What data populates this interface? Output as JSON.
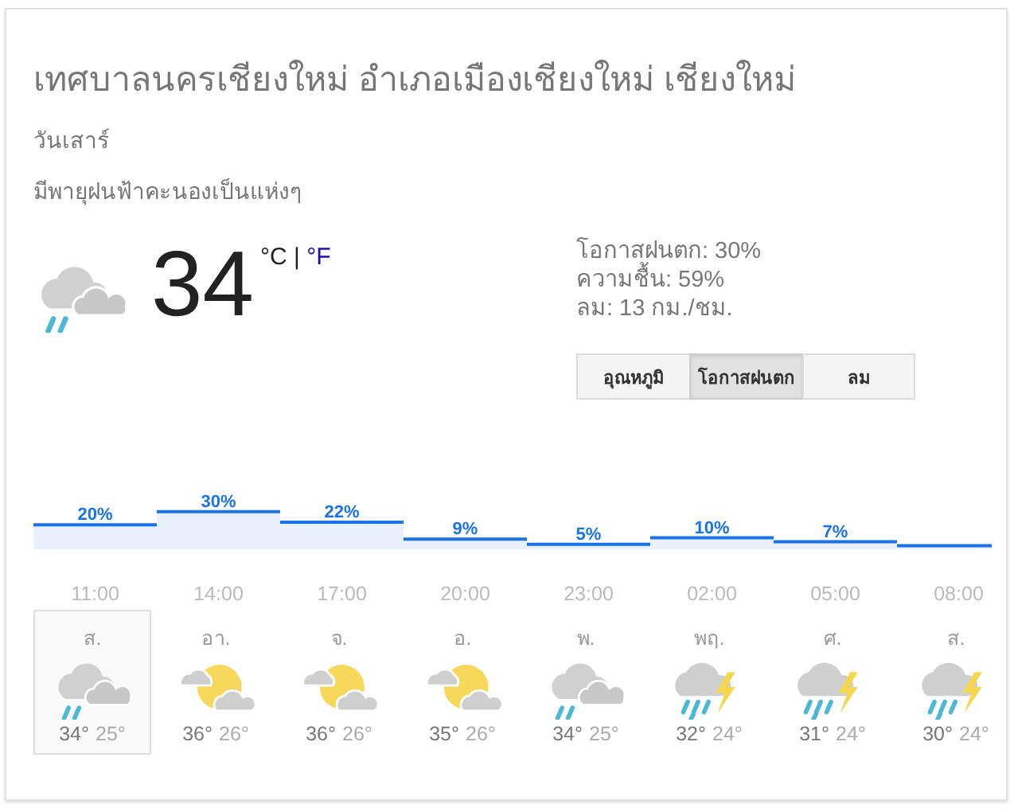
{
  "location": "เทศบาลนครเชียงใหม่ อำเภอเมืองเชียงใหม่ เชียงใหม่",
  "day": "วันเสาร์",
  "condition": "มีพายุฝนฟ้าคะนองเป็นแห่งๆ",
  "current": {
    "kind": "rain",
    "temperature": "34",
    "unit_c": "°C",
    "separator": "|",
    "unit_f": "°F"
  },
  "details": [
    "โอกาสฝนตก: 30%",
    "ความชื้น: 59%",
    "ลม: 13 กม./ชม."
  ],
  "tabs": [
    {
      "label": "อุณหภูมิ",
      "selected": false
    },
    {
      "label": "โอกาสฝนตก",
      "selected": true
    },
    {
      "label": "ลม",
      "selected": false
    }
  ],
  "chart": {
    "chart_data": {
      "type": "bar",
      "categories": [
        "11:00",
        "14:00",
        "17:00",
        "20:00",
        "23:00",
        "02:00",
        "05:00",
        "08:00"
      ],
      "values": [
        20,
        30,
        22,
        9,
        5,
        10,
        7,
        4
      ],
      "value_labels": [
        "20%",
        "30%",
        "22%",
        "9%",
        "5%",
        "10%",
        "7%",
        null
      ]
    }
  },
  "days": [
    {
      "name": "ส.",
      "kind": "rain",
      "high": "34°",
      "low": "25°",
      "selected": true
    },
    {
      "name": "อา.",
      "kind": "partly-cloudy",
      "high": "36°",
      "low": "26°",
      "selected": false
    },
    {
      "name": "จ.",
      "kind": "partly-cloudy",
      "high": "36°",
      "low": "26°",
      "selected": false
    },
    {
      "name": "อ.",
      "kind": "partly-cloudy",
      "high": "35°",
      "low": "26°",
      "selected": false
    },
    {
      "name": "พ.",
      "kind": "rain",
      "high": "34°",
      "low": "25°",
      "selected": false
    },
    {
      "name": "พฤ.",
      "kind": "storm",
      "high": "32°",
      "low": "24°",
      "selected": false
    },
    {
      "name": "ศ.",
      "kind": "storm",
      "high": "31°",
      "low": "24°",
      "selected": false
    },
    {
      "name": "ส.",
      "kind": "storm",
      "high": "30°",
      "low": "24°",
      "selected": false
    }
  ]
}
